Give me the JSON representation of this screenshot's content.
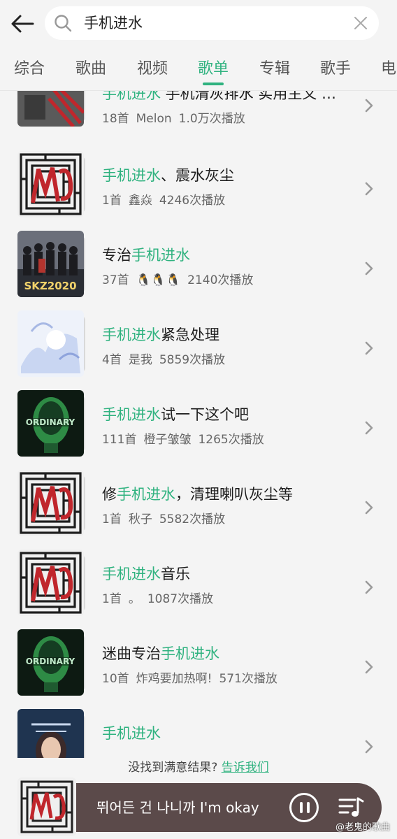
{
  "search": {
    "query": "手机进水"
  },
  "tabs": [
    {
      "label": "综合"
    },
    {
      "label": "歌曲"
    },
    {
      "label": "视频"
    },
    {
      "label": "歌单"
    },
    {
      "label": "专辑"
    },
    {
      "label": "歌手"
    },
    {
      "label": "电"
    }
  ],
  "active_tab": "歌单",
  "colors": {
    "accent": "#2fb27f",
    "player_bar": "#5b4a4a"
  },
  "playlists": [
    {
      "pre": "",
      "hl": "手机进水",
      "post": " 手机清灰排水 实用主义 …",
      "count": "18首",
      "creator": "Melon",
      "plays": "1.0万次播放",
      "cover": "city"
    },
    {
      "pre": "",
      "hl": "手机进水",
      "post": "、震水灰尘",
      "count": "1首",
      "creator": "鑫焱",
      "plays": "4246次播放",
      "cover": "maze"
    },
    {
      "pre": "专治",
      "hl": "手机进水",
      "post": "",
      "count": "37首",
      "creator": "🐧🐧🐧",
      "plays": "2140次播放",
      "cover": "band"
    },
    {
      "pre": "",
      "hl": "手机进水",
      "post": "紧急处理",
      "count": "4首",
      "creator": "是我",
      "plays": "5859次播放",
      "cover": "art"
    },
    {
      "pre": "",
      "hl": "手机进水",
      "post": "试一下这个吧",
      "count": "111首",
      "creator": "橙子皱皱",
      "plays": "1265次播放",
      "cover": "ordinary"
    },
    {
      "pre": "修",
      "hl": "手机进水",
      "post": "，清理喇叭灰尘等",
      "count": "1首",
      "creator": "秋子",
      "plays": "5582次播放",
      "cover": "maze"
    },
    {
      "pre": "",
      "hl": "手机进水",
      "post": "音乐",
      "count": "1首",
      "creator": "。",
      "plays": "1087次播放",
      "cover": "maze"
    },
    {
      "pre": "迷曲专治",
      "hl": "手机进水",
      "post": "",
      "count": "10首",
      "creator": "炸鸡要加热啊!",
      "plays": "571次播放",
      "cover": "ordinary"
    },
    {
      "pre": "",
      "hl": "手机进水",
      "post": "",
      "count": "",
      "creator": "",
      "plays": "",
      "cover": "girl"
    }
  ],
  "not_found": {
    "text": "没找到满意结果?",
    "link": "告诉我们"
  },
  "player": {
    "title": "뛰어든 건 나니까 I'm okay"
  },
  "watermark": "@老鬼的歌曲"
}
